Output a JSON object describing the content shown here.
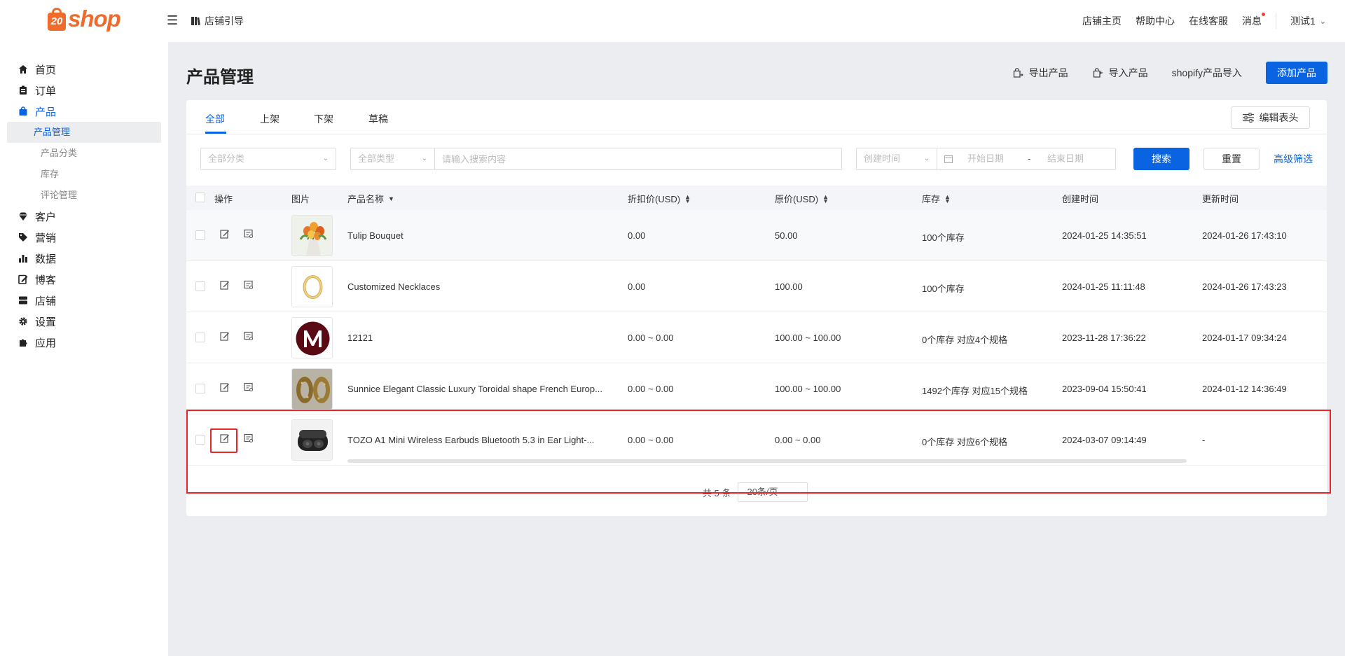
{
  "brand": {
    "logo_mark": "20",
    "logo_text": "shop",
    "color": "#ee6b2c"
  },
  "topbar": {
    "store_guide": "店铺引导",
    "links": [
      "店铺主页",
      "帮助中心",
      "在线客服",
      "消息"
    ],
    "user": "测试1"
  },
  "sidebar": {
    "items": [
      {
        "label": "首页",
        "icon": "home-icon"
      },
      {
        "label": "订单",
        "icon": "clipboard-icon"
      },
      {
        "label": "产品",
        "icon": "bag-icon",
        "active": true
      },
      {
        "label": "客户",
        "icon": "diamond-icon"
      },
      {
        "label": "营销",
        "icon": "tag-icon"
      },
      {
        "label": "数据",
        "icon": "bar-chart-icon"
      },
      {
        "label": "博客",
        "icon": "edit-note-icon"
      },
      {
        "label": "店铺",
        "icon": "store-icon"
      },
      {
        "label": "设置",
        "icon": "gear-icon"
      },
      {
        "label": "应用",
        "icon": "puzzle-icon"
      }
    ],
    "product_sub": [
      "产品管理",
      "产品分类",
      "库存",
      "评论管理"
    ]
  },
  "page": {
    "title": "产品管理",
    "export_label": "导出产品",
    "import_label": "导入产品",
    "shopify_label": "shopify产品导入",
    "add_label": "添加产品"
  },
  "tabs": [
    "全部",
    "上架",
    "下架",
    "草稿"
  ],
  "edit_header_label": "编辑表头",
  "filters": {
    "category": "全部分类",
    "type": "全部类型",
    "search_placeholder": "请输入搜索内容",
    "time_field": "创建时间",
    "start_placeholder": "开始日期",
    "range_sep": "-",
    "end_placeholder": "结束日期",
    "search_label": "搜索",
    "reset_label": "重置",
    "advanced_label": "高级筛选"
  },
  "table": {
    "headers": {
      "action": "操作",
      "image": "图片",
      "name": "产品名称",
      "discount": "折扣价(USD)",
      "price": "原价(USD)",
      "stock": "库存",
      "created": "创建时间",
      "updated": "更新时间"
    },
    "rows": [
      {
        "name": "Tulip Bouquet",
        "discount": "0.00",
        "price": "50.00",
        "stock": "100个库存",
        "created": "2024-01-25 14:35:51",
        "updated": "2024-01-26 17:43:10",
        "thumb": "tulip"
      },
      {
        "name": "Customized Necklaces",
        "discount": "0.00",
        "price": "100.00",
        "stock": "100个库存",
        "created": "2024-01-25 11:11:48",
        "updated": "2024-01-26 17:43:23",
        "thumb": "necklace"
      },
      {
        "name": "12121",
        "discount": "0.00 ~ 0.00",
        "price": "100.00 ~ 100.00",
        "stock": "0个库存 对应4个规格",
        "created": "2023-11-28 17:36:22",
        "updated": "2024-01-17 09:34:24",
        "thumb": "m-logo"
      },
      {
        "name": "Sunnice Elegant Classic Luxury Toroidal shape French Europ...",
        "discount": "0.00 ~ 0.00",
        "price": "100.00 ~ 100.00",
        "stock": "1492个库存 对应15个规格",
        "created": "2023-09-04 15:50:41",
        "updated": "2024-01-12 14:36:49",
        "thumb": "earrings"
      },
      {
        "name": "TOZO A1 Mini Wireless Earbuds Bluetooth 5.3 in Ear Light-...",
        "discount": "0.00 ~ 0.00",
        "price": "0.00 ~ 0.00",
        "stock": "0个库存 对应6个规格",
        "created": "2024-03-07 09:14:49",
        "updated": "-",
        "thumb": "earbuds"
      }
    ]
  },
  "pager": {
    "total": "共 5 条",
    "page_size": "20条/页"
  }
}
